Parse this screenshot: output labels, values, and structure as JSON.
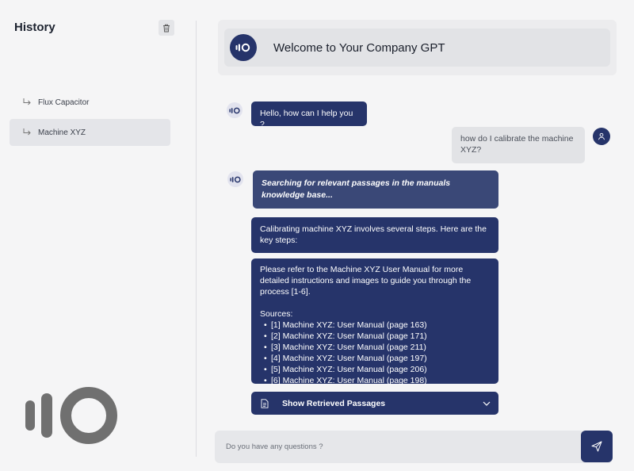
{
  "sidebar": {
    "title": "History",
    "items": [
      {
        "label": "Flux Capacitor"
      },
      {
        "label": "Machine XYZ"
      }
    ]
  },
  "header": {
    "title": "Welcome to Your Company GPT"
  },
  "messages": {
    "greeting": "Hello, how can I help you ?",
    "user_question": "how do I calibrate the machine XYZ?",
    "searching": "Searching for relevant passages in the manuals knowledge base...",
    "calibration_intro": "Calibrating machine XYZ involves several steps. Here are the key steps:",
    "refer_text": "Please refer to the Machine XYZ User Manual for more detailed instructions and images to guide you through the process [1-6].",
    "sources_label": "Sources:",
    "sources": [
      "[1] Machine XYZ: User Manual (page 163)",
      "[2] Machine XYZ: User Manual (page 171)",
      "[3] Machine XYZ: User Manual (page 211)",
      "[4] Machine XYZ: User Manual (page 197)",
      "[5] Machine XYZ: User Manual (page 206)",
      "[6] Machine XYZ: User Manual (page 198)"
    ]
  },
  "retrieved": {
    "label": "Show Retrieved Passages"
  },
  "input": {
    "placeholder": "Do you have any questions ?"
  },
  "icons": {
    "trash": "trash-icon",
    "reply_arrow": "reply-arrow-icon",
    "logo": "logo-icon",
    "user": "user-icon",
    "document": "document-icon",
    "chevron": "chevron-down-icon",
    "send": "send-icon"
  },
  "colors": {
    "accent": "#26346a",
    "accent_light": "#3a4877",
    "background": "#f5f5f6",
    "logo_gray": "#707070"
  }
}
